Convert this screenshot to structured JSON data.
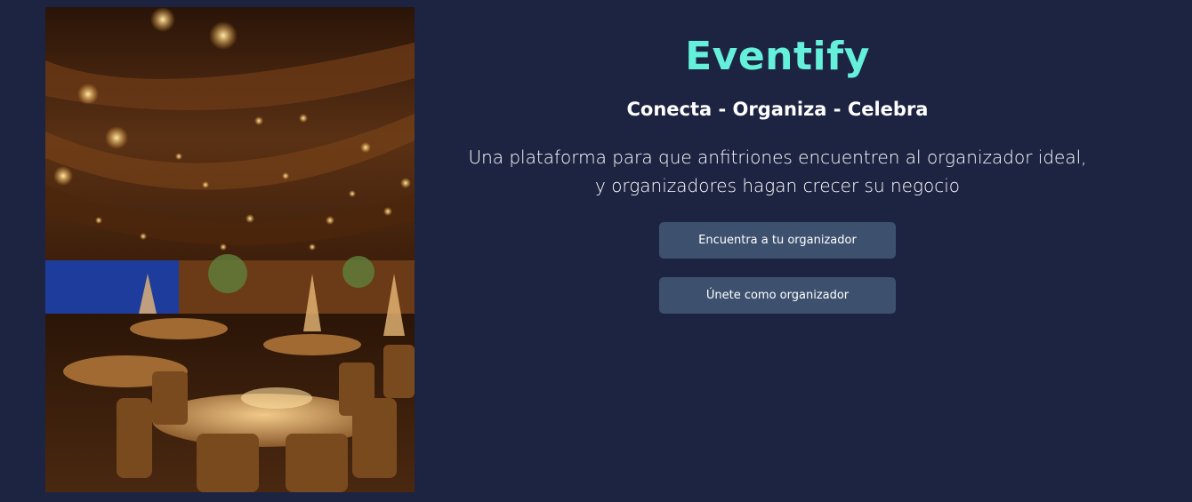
{
  "hero": {
    "brand": "Eventify",
    "tagline": "Conecta - Organiza - Celebra",
    "description_line1": "Una plataforma para que anfitriones encuentren al organizador ideal,",
    "description_line2": "y organizadores hagan crecer su negocio"
  },
  "actions": {
    "find_organizer_label": "Encuentra a tu organizador",
    "join_organizer_label": "Únete como organizador"
  },
  "colors": {
    "background": "#1d2442",
    "brand_accent": "#64f0db",
    "button_bg": "#3d516f"
  }
}
